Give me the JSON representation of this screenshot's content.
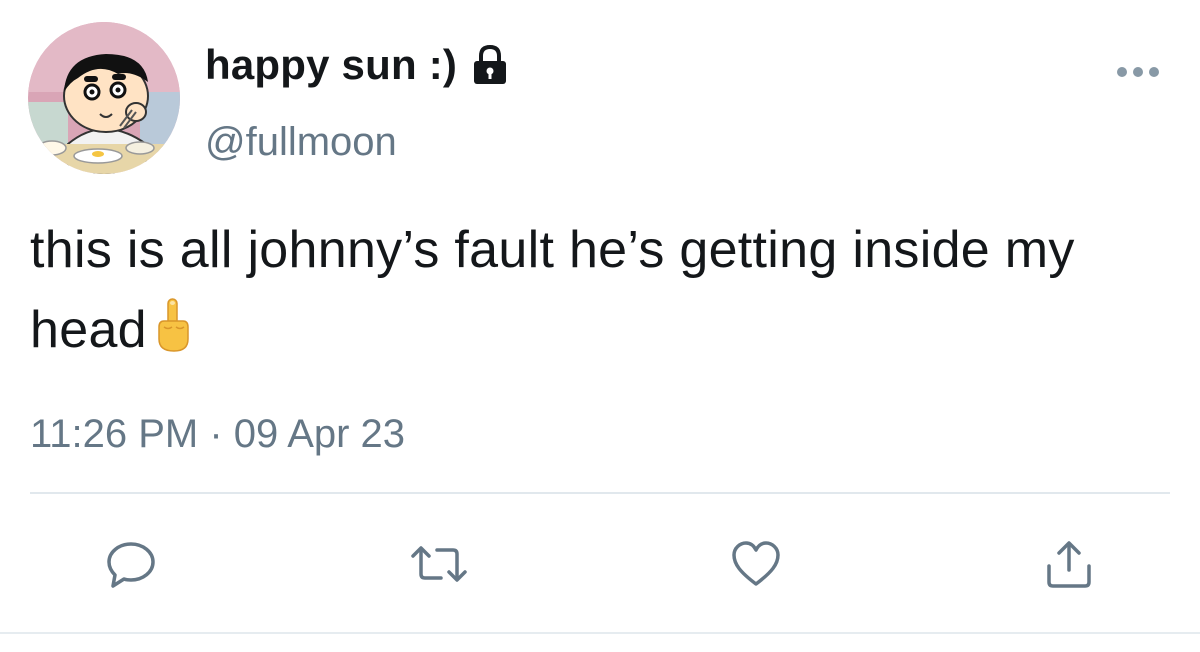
{
  "tweet": {
    "display_name": "happy sun :)",
    "handle": "@fullmoon",
    "text": "this is all johnny’s fault he’s getting inside my head",
    "emoji": "middle-finger-emoji",
    "timestamp": "11:26 PM · 09 Apr 23",
    "protected_account": true
  },
  "icons": {
    "avatar": "cartoon-boy-eating-avatar",
    "lock": "lock-icon",
    "more": "more-options-icon",
    "reply": "reply-icon",
    "retweet": "retweet-icon",
    "like": "heart-icon",
    "share": "share-icon"
  },
  "colors": {
    "text": "#14171a",
    "secondary": "#657786",
    "divider": "#e1e8ed",
    "icon": "#657786"
  }
}
